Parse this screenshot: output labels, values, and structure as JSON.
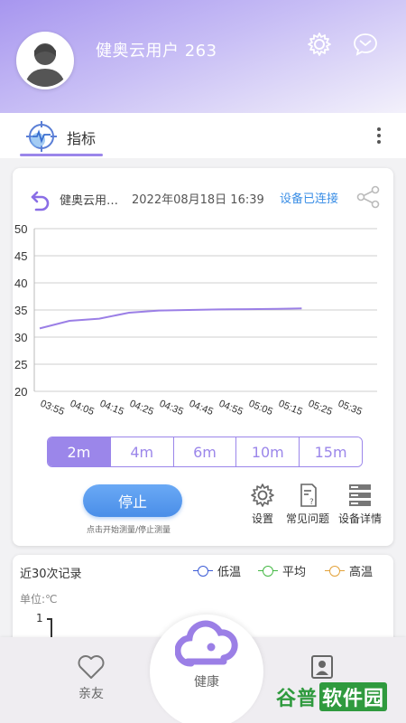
{
  "header": {
    "username": "健奥云用户 263",
    "icons": [
      "settings-gear-icon",
      "message-bubble-icon"
    ],
    "gradient": [
      "#a796ef",
      "#f3f1fb"
    ]
  },
  "tabbar": {
    "tab_label": "指标",
    "accent": "#9b86ea"
  },
  "device": {
    "name": "健奥云用…",
    "datetime": "2022年08月18日 16:39",
    "status": "设备已连接"
  },
  "chart_data": {
    "type": "line",
    "x": [
      "03:55",
      "04:05",
      "04:15",
      "04:25",
      "04:35",
      "04:45",
      "04:55",
      "05:05",
      "05:15",
      "05:25",
      "05:35"
    ],
    "ylim": [
      20,
      50
    ],
    "yticks": [
      50,
      45,
      40,
      35,
      30,
      20,
      25
    ],
    "ytick_labels": [
      "50",
      "45",
      "40",
      "35",
      "30",
      "25",
      "20"
    ],
    "grid": true,
    "series": [
      {
        "color": "#9b7fe6",
        "points": [
          [
            0,
            31.6
          ],
          [
            1,
            33.0
          ],
          [
            2,
            33.4
          ],
          [
            3,
            34.5
          ],
          [
            4,
            34.9
          ],
          [
            5,
            35.0
          ],
          [
            6,
            35.1
          ],
          [
            7,
            35.15
          ],
          [
            8,
            35.2
          ],
          [
            8.8,
            35.3
          ]
        ]
      }
    ]
  },
  "durations": {
    "options": [
      "2m",
      "4m",
      "6m",
      "10m",
      "15m"
    ],
    "selected": "2m"
  },
  "controls": {
    "stop_label": "停止",
    "stop_hint": "点击开始测量/停止测量",
    "settings_label": "设置",
    "faq_label": "常见问题",
    "details_label": "设备详情"
  },
  "records": {
    "title": "近30次记录",
    "legend": [
      {
        "label": "低温",
        "color": "#3b5bd6"
      },
      {
        "label": "平均",
        "color": "#44b844"
      },
      {
        "label": "高温",
        "color": "#e3a23a"
      }
    ],
    "unit": "单位:℃",
    "first_tick": "1"
  },
  "nav": {
    "friends_label": "亲友",
    "health_label": "健康",
    "watermark_a": "谷普",
    "watermark_b": "软件园"
  }
}
